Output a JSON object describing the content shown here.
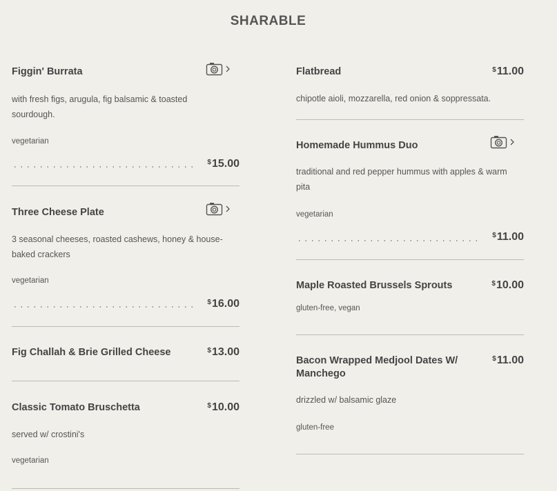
{
  "section_title": "SHARABLE",
  "currency_symbol": "$",
  "icons": {
    "photo": "camera-icon",
    "arrow": "chevron-right-icon"
  },
  "left_items": [
    {
      "name": "Figgin' Burrata",
      "description": "with fresh figs, arugula, fig balsamic & toasted sourdough.",
      "tag": "vegetarian",
      "price": "15.00",
      "has_photo": true
    },
    {
      "name": "Three Cheese Plate",
      "description": "3 seasonal cheeses, roasted cashews, honey & house-baked crackers",
      "tag": "vegetarian",
      "price": "16.00",
      "has_photo": true
    },
    {
      "name": "Fig Challah & Brie Grilled Cheese",
      "price": "13.00"
    },
    {
      "name": "Classic Tomato Bruschetta",
      "description": "served w/ crostini's",
      "tag": "vegetarian",
      "price": "10.00"
    }
  ],
  "right_items": [
    {
      "name": "Flatbread",
      "description": "chipotle aioli, mozzarella, red onion & soppressata.",
      "price": "11.00"
    },
    {
      "name": "Homemade Hummus Duo",
      "description": "traditional and red pepper hummus with apples & warm pita",
      "tag": "vegetarian",
      "price": "11.00",
      "has_photo": true
    },
    {
      "name": "Maple Roasted Brussels Sprouts",
      "tag": "gluten-free, vegan",
      "price": "10.00"
    },
    {
      "name": "Bacon Wrapped Medjool Dates W/ Manchego",
      "description": "drizzled w/ balsamic glaze",
      "tag": "gluten-free",
      "price": "11.00"
    }
  ]
}
